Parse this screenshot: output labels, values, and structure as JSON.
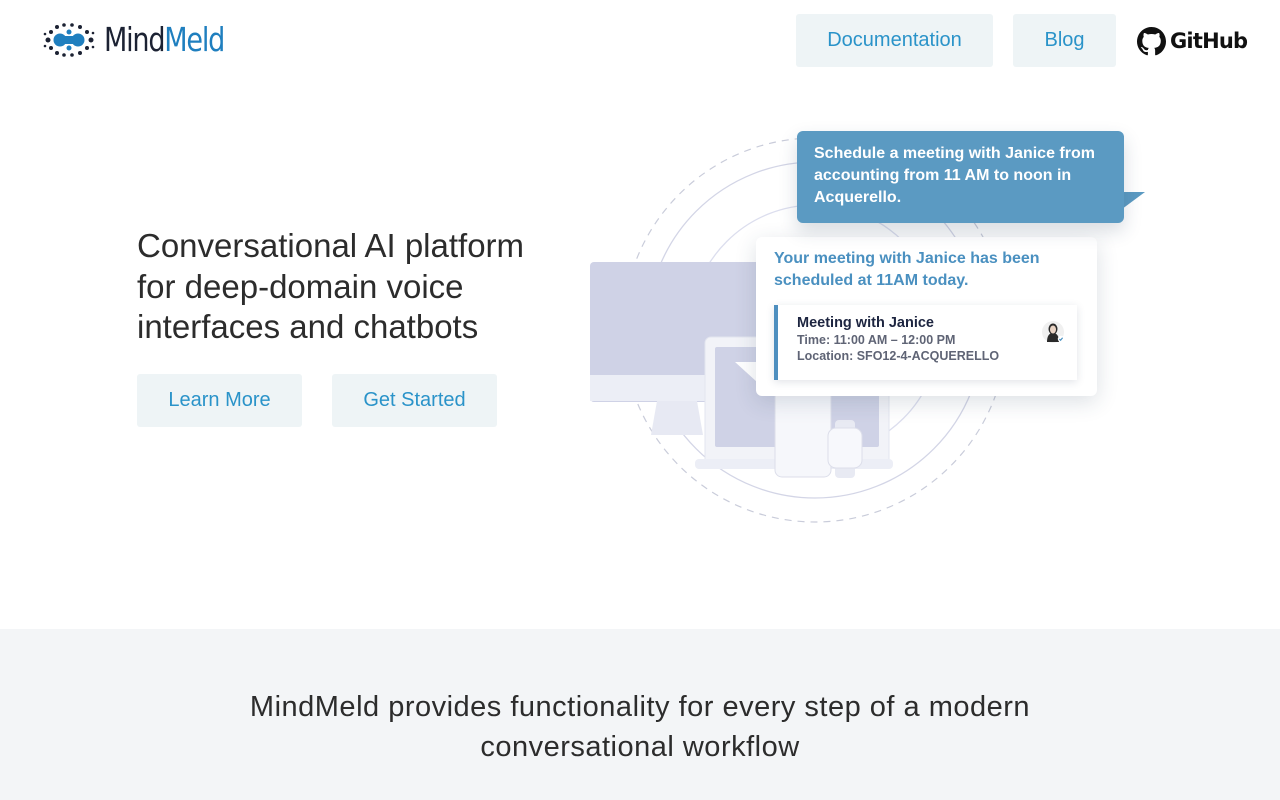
{
  "brand": {
    "name_part1": "Mind",
    "name_part2": "Meld",
    "primary_color": "#1f7fbf",
    "dark_color": "#1c2233"
  },
  "nav": {
    "documentation_label": "Documentation",
    "blog_label": "Blog",
    "github_label": "GitHub"
  },
  "hero": {
    "title": "Conversational AI platform for deep-domain voice interfaces and chatbots",
    "learn_more_label": "Learn More",
    "get_started_label": "Get Started"
  },
  "illustration": {
    "user_message": "Schedule a meeting with Janice from accounting from 11 AM to noon in Acquerello.",
    "bot_reply": "Your meeting with Janice has been scheduled at 11AM today.",
    "card": {
      "title": "Meeting with Janice",
      "time": "Time: 11:00 AM – 12:00 PM",
      "location": "Location: SFO12-4-ACQUERELLO"
    }
  },
  "features": {
    "headline": "MindMeld provides functionality for every step of a modern conversational workflow"
  },
  "colors": {
    "button_bg": "#eef4f6",
    "button_text": "#2a93c9",
    "bubble_blue": "#5b9ac2",
    "band_bg": "#f3f5f7"
  }
}
